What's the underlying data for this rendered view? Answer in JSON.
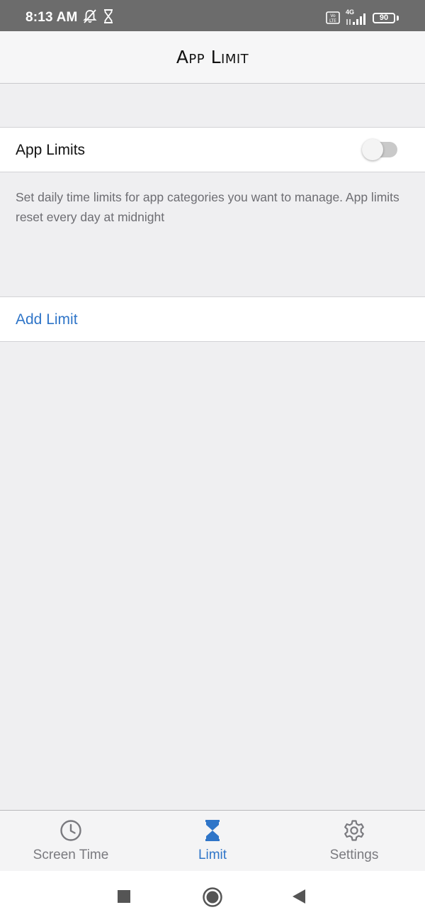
{
  "status_bar": {
    "time": "8:13 AM",
    "network": "4G",
    "battery": "90",
    "icons": [
      "bell-off-icon",
      "hourglass-icon",
      "volte-icon",
      "signal-icon",
      "battery-icon"
    ]
  },
  "nav": {
    "title": "App Limit"
  },
  "settings": {
    "toggle_label": "App Limits",
    "toggle_on": false,
    "description": "Set daily time limits for app categories you want to manage. App limits reset every day at midnight",
    "add_limit_label": "Add Limit"
  },
  "tabs": [
    {
      "label": "Screen Time",
      "icon": "clock-icon",
      "active": false
    },
    {
      "label": "Limit",
      "icon": "hourglass-icon",
      "active": true
    },
    {
      "label": "Settings",
      "icon": "gear-icon",
      "active": false
    }
  ],
  "system_nav": {
    "buttons": [
      "recents-button",
      "home-button",
      "back-button"
    ]
  },
  "colors": {
    "accent": "#2f75c8",
    "status_bar": "#6c6c6c",
    "background": "#efeff1"
  }
}
